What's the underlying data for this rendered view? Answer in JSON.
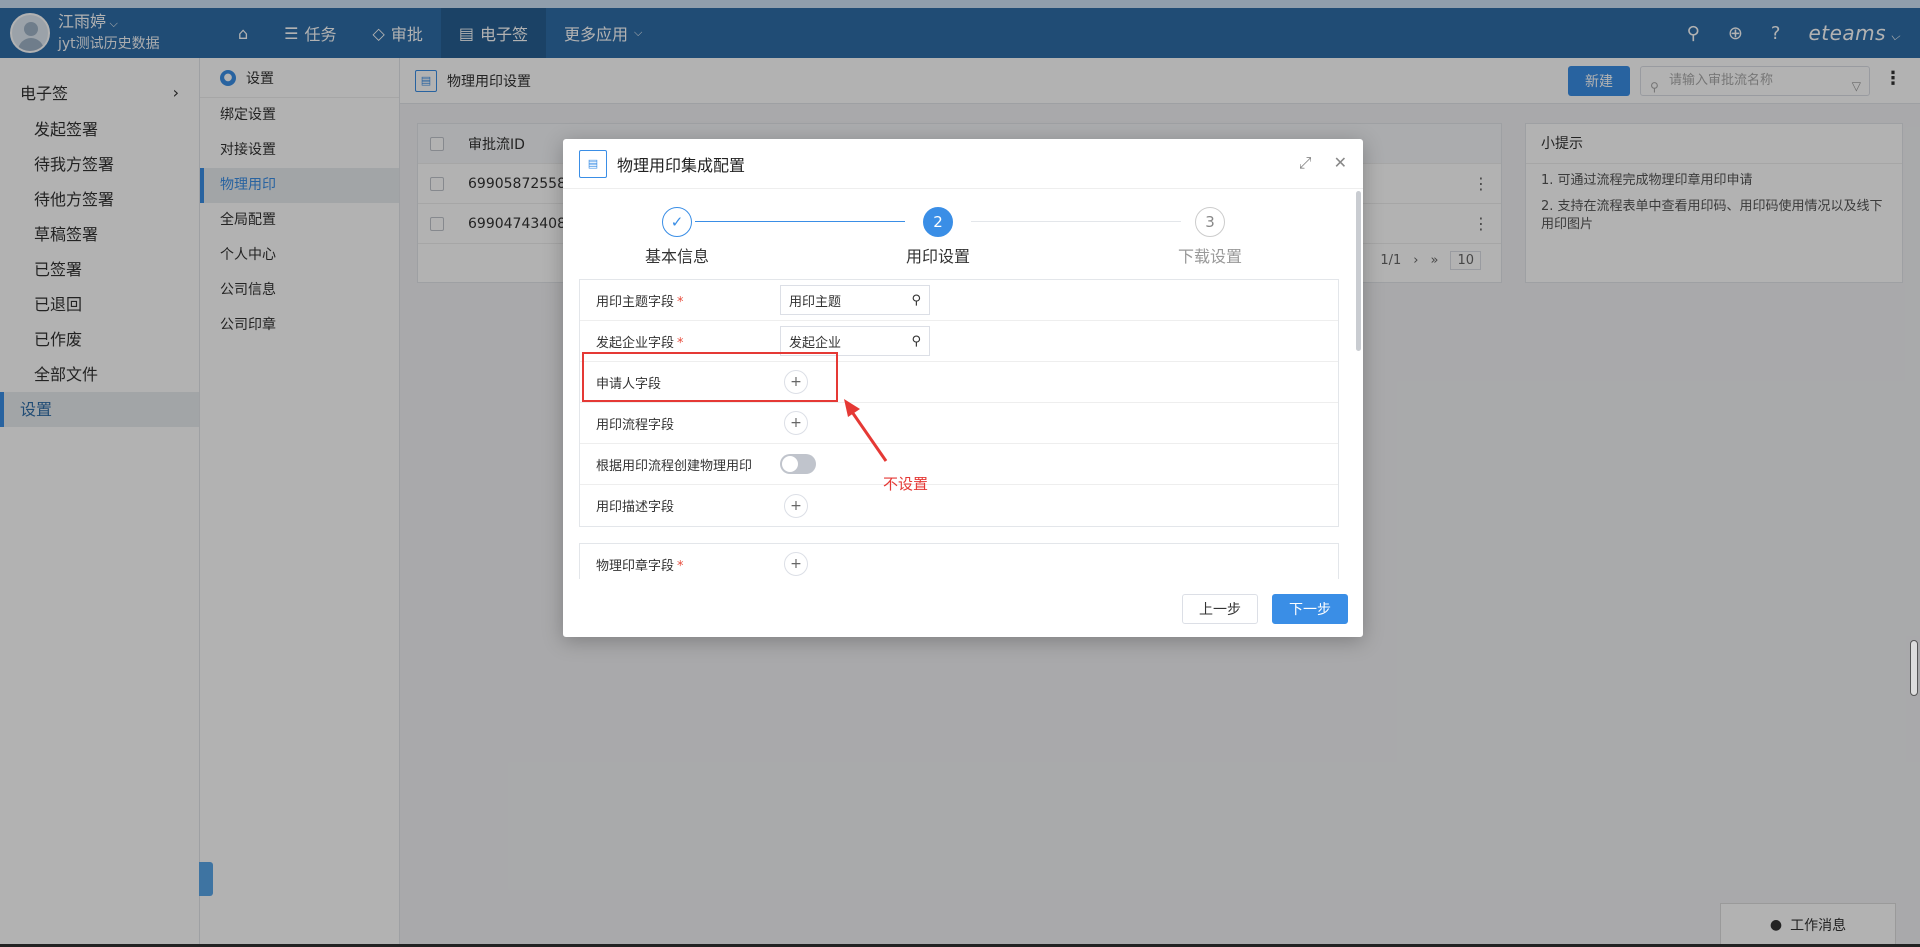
{
  "topbar": {
    "user_name": "江雨婷",
    "user_sub": "jyt测试历史数据",
    "nav": [
      {
        "label": ""
      },
      {
        "label": "任务"
      },
      {
        "label": "审批"
      },
      {
        "label": "电子签"
      },
      {
        "label": "更多应用"
      }
    ],
    "brand": "eteams"
  },
  "sidebar1": {
    "title": "电子签",
    "items": [
      "发起签署",
      "待我方签署",
      "待他方签署",
      "草稿签署",
      "已签署",
      "已退回",
      "已作废",
      "全部文件",
      "设置"
    ]
  },
  "sidebar2": {
    "title": "设置",
    "items": [
      "绑定设置",
      "对接设置",
      "物理用印",
      "全局配置",
      "个人中心",
      "公司信息",
      "公司印章"
    ]
  },
  "content": {
    "title": "物理用印设置",
    "new_button": "新建",
    "search_placeholder": "请输入审批流名称",
    "table": {
      "col_id": "审批流ID",
      "rows": [
        "69905872558",
        "69904743408"
      ]
    },
    "pager": {
      "page": "1/1",
      "size": "10"
    }
  },
  "tips": {
    "title": "小提示",
    "items": [
      "1. 可通过流程完成物理印章用印申请",
      "2. 支持在流程表单中查看用印码、用印码使用情况以及线下用印图片"
    ]
  },
  "modal": {
    "title": "物理用印集成配置",
    "steps": [
      {
        "num": "✓",
        "label": "基本信息"
      },
      {
        "num": "2",
        "label": "用印设置"
      },
      {
        "num": "3",
        "label": "下载设置"
      }
    ],
    "fields": {
      "subject_label": "用印主题字段",
      "subject_value": "用印主题",
      "company_label": "发起企业字段",
      "company_value": "发起企业",
      "applicant_label": "申请人字段",
      "process_label": "用印流程字段",
      "create_label": "根据用印流程创建物理用印",
      "desc_label": "用印描述字段",
      "seal_label": "物理印章字段"
    },
    "prev_button": "上一步",
    "next_button": "下一步"
  },
  "annotation": {
    "text": "不设置"
  },
  "footer": {
    "message_button": "工作消息"
  },
  "colors": {
    "primary": "#3a8ee6",
    "header": "#2f6ea8",
    "annotation": "#e53935"
  }
}
